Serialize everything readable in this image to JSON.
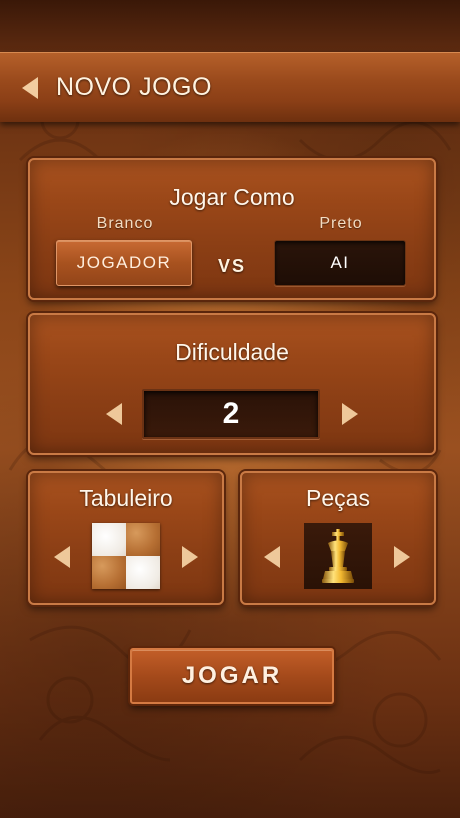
{
  "header": {
    "title": "NOVO JOGO",
    "back_icon": "chevron-left-icon"
  },
  "play_as": {
    "title": "Jogar Como",
    "white_label": "Branco",
    "black_label": "Preto",
    "white_value": "JOGADOR",
    "black_value": "AI",
    "vs_text": "VS"
  },
  "difficulty": {
    "title": "Dificuldade",
    "value": "2",
    "prev_icon": "chevron-left-icon",
    "next_icon": "chevron-right-icon"
  },
  "board": {
    "title": "Tabuleiro",
    "prev_icon": "chevron-left-icon",
    "next_icon": "chevron-right-icon",
    "preview_icon": "board-preview-icon"
  },
  "pieces": {
    "title": "Peças",
    "prev_icon": "chevron-left-icon",
    "next_icon": "chevron-right-icon",
    "preview_icon": "king-piece-icon"
  },
  "play_button": {
    "label": "JOGAR"
  },
  "colors": {
    "accent_wood": "#a9521f",
    "dark_box": "#1e0d05",
    "arrow": "#eec89a"
  }
}
